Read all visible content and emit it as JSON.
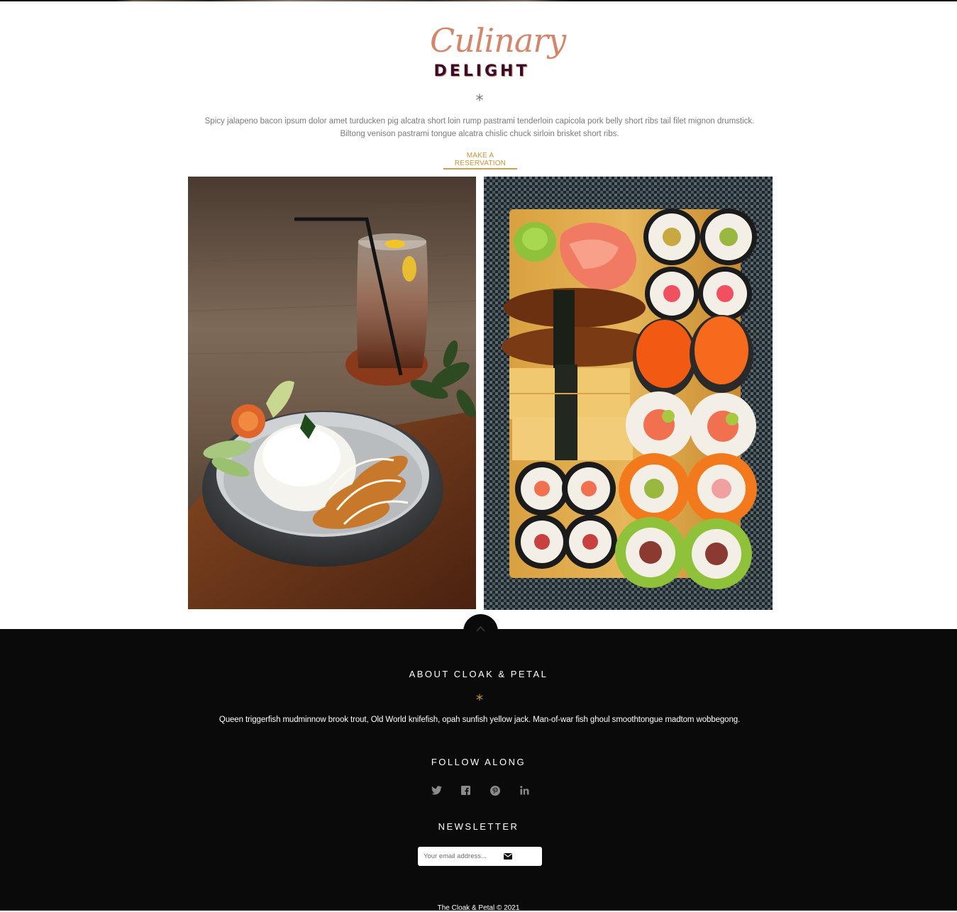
{
  "brand": {
    "script": "Culinary",
    "word": "DELIGHT",
    "script_color": "#d4866a",
    "word_color": "#3b0b2a"
  },
  "hero": {
    "divider": "*",
    "intro": "Spicy jalapeno bacon ipsum dolor amet turducken pig alcatra short loin rump pastrami tenderloin capicola pork belly short ribs tail filet mignon drumstick. Biltong venison pastrami tongue alcatra chislic chuck sirloin brisket short ribs.",
    "cta_label": "MAKE A RESERVATION",
    "accent_color": "#c8923a"
  },
  "gallery": {
    "images": [
      {
        "subject": "rice bowl with fried shrimp and iced drink"
      },
      {
        "subject": "sushi platter on wooden board"
      }
    ]
  },
  "footer": {
    "scroll_top_icon": "chevron-up-icon",
    "about_heading": "ABOUT CLOAK & PETAL",
    "about_divider": "*",
    "about_text": "Queen triggerfish mudminnow brook trout, Old World knifefish, opah sunfish yellow jack. Man-of-war fish ghoul smoothtongue madtom wobbegong.",
    "follow_heading": "FOLLOW ALONG",
    "social": [
      {
        "name": "twitter",
        "icon": "twitter-icon"
      },
      {
        "name": "facebook",
        "icon": "facebook-icon"
      },
      {
        "name": "pinterest",
        "icon": "pinterest-icon"
      },
      {
        "name": "linkedin",
        "icon": "linkedin-icon"
      }
    ],
    "newsletter_heading": "NEWSLETTER",
    "newsletter_placeholder": "Your email address...",
    "newsletter_button_icon": "envelope-icon",
    "copyright": "The Cloak & Petal © 2021",
    "background": "#0a0a0a",
    "icon_color": "#8a8a8a"
  }
}
